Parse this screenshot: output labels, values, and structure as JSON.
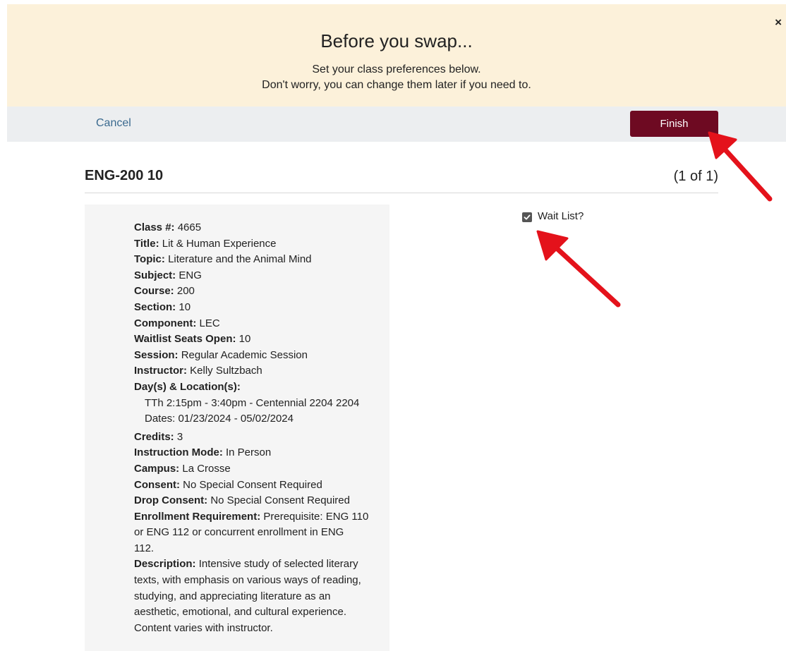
{
  "banner": {
    "title": "Before you swap...",
    "subtitle_line1": "Set your class preferences below.",
    "subtitle_line2": "Don't worry, you can change them later if you need to.",
    "close_label": "×"
  },
  "actions": {
    "cancel_label": "Cancel",
    "finish_label": "Finish"
  },
  "class": {
    "code": "ENG-200 10",
    "count": "(1 of 1)",
    "details": {
      "class_number_label": "Class #:",
      "class_number": "4665",
      "title_label": "Title:",
      "title": "Lit & Human Experience",
      "topic_label": "Topic:",
      "topic": "Literature and the Animal Mind",
      "subject_label": "Subject:",
      "subject": "ENG",
      "course_label": "Course:",
      "course": "200",
      "section_label": "Section:",
      "section": "10",
      "component_label": "Component:",
      "component": "LEC",
      "waitlist_seats_label": "Waitlist Seats Open:",
      "waitlist_seats": "10",
      "session_label": "Session:",
      "session": "Regular Academic Session",
      "instructor_label": "Instructor:",
      "instructor": "Kelly Sultzbach",
      "days_locations_label": "Day(s) & Location(s):",
      "meeting": "TTh 2:15pm - 3:40pm - Centennial 2204 2204",
      "dates": "Dates: 01/23/2024 - 05/02/2024",
      "credits_label": "Credits:",
      "credits": "3",
      "instruction_mode_label": "Instruction Mode:",
      "instruction_mode": "In Person",
      "campus_label": "Campus:",
      "campus": "La Crosse",
      "consent_label": "Consent:",
      "consent": "No Special Consent Required",
      "drop_consent_label": "Drop Consent:",
      "drop_consent": "No Special Consent Required",
      "enrollment_req_label": "Enrollment Requirement:",
      "enrollment_req_line1": "Prerequisite: ENG 110",
      "enrollment_req_line2": "or ENG 112 or concurrent enrollment in ENG",
      "enrollment_req_line3": "112.",
      "description_label": "Description:",
      "description_line1": "Intensive study of selected literary",
      "description_line2": "texts, with emphasis on various ways of reading,",
      "description_line3": "studying, and appreciating literature as an",
      "description_line4": "aesthetic, emotional, and cultural experience.",
      "description_line5": "Content varies with instructor."
    }
  },
  "waitlist": {
    "label": "Wait List?",
    "checked": true
  },
  "colors": {
    "banner_bg": "#fcf1da",
    "action_bar_bg": "#eceef0",
    "finish_bg": "#6e0a22",
    "link": "#3b6a8f",
    "arrow": "#e4121b"
  }
}
